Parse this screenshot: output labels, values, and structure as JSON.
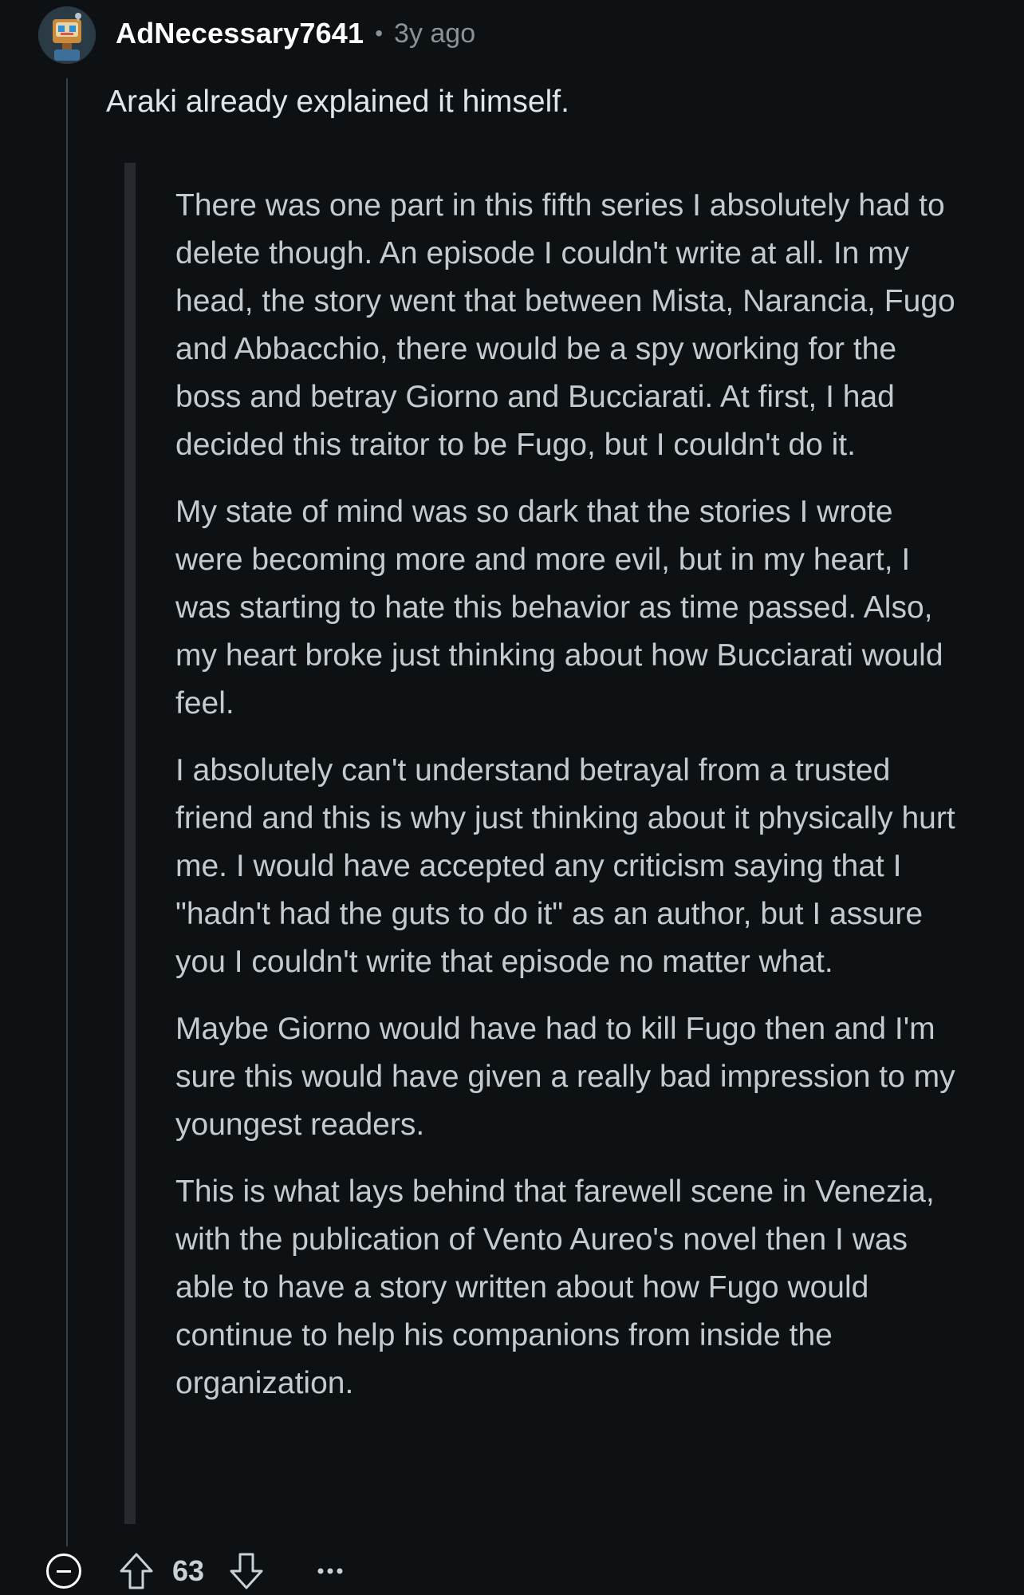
{
  "comment": {
    "username": "AdNecessary7641",
    "separator": "•",
    "timestamp": "3y ago",
    "avatar_icon": "robot-avatar-icon",
    "body": "Araki already explained it himself.",
    "quote_paragraphs": [
      "There was one part in this fifth series I absolutely had to delete though. An episode I couldn't write at all. In my head, the story went that between Mista, Narancia, Fugo and Abbacchio, there would be a spy working for the boss and betray Giorno and Bucciarati. At first, I had decided this traitor to be Fugo, but I couldn't do it.",
      "My state of mind was so dark that the stories I wrote were becoming more and more evil, but in my heart, I was starting to hate this behavior as time passed. Also, my heart broke just thinking about how Bucciarati would feel.",
      "I absolutely can't understand betrayal from a trusted friend and this is why just thinking about it physically hurt me. I would have accepted any criticism saying that I \"hadn't had the guts to do it\" as an author, but I assure you I couldn't write that episode no matter what.",
      "Maybe Giorno would have had to kill Fugo then and I'm sure this would have given a really bad impression to my youngest readers.",
      "This is what lays behind that farewell scene in Venezia, with the publication of Vento Aureo's novel then I was able to have a story written about how Fugo would continue to help his companions from inside the organization."
    ]
  },
  "actions": {
    "collapse_icon": "collapse-minus-icon",
    "upvote_icon": "upvote-arrow-icon",
    "score": "63",
    "downvote_icon": "downvote-arrow-icon",
    "more_icon": "more-options-icon"
  },
  "colors": {
    "background": "#0e1113",
    "username": "#ffffff",
    "meta": "#8a9296",
    "body_text": "#dfe6ea",
    "quote_text": "#c3cbcf",
    "quote_bar": "#262a2e",
    "thread_line": "#3a3f44"
  }
}
